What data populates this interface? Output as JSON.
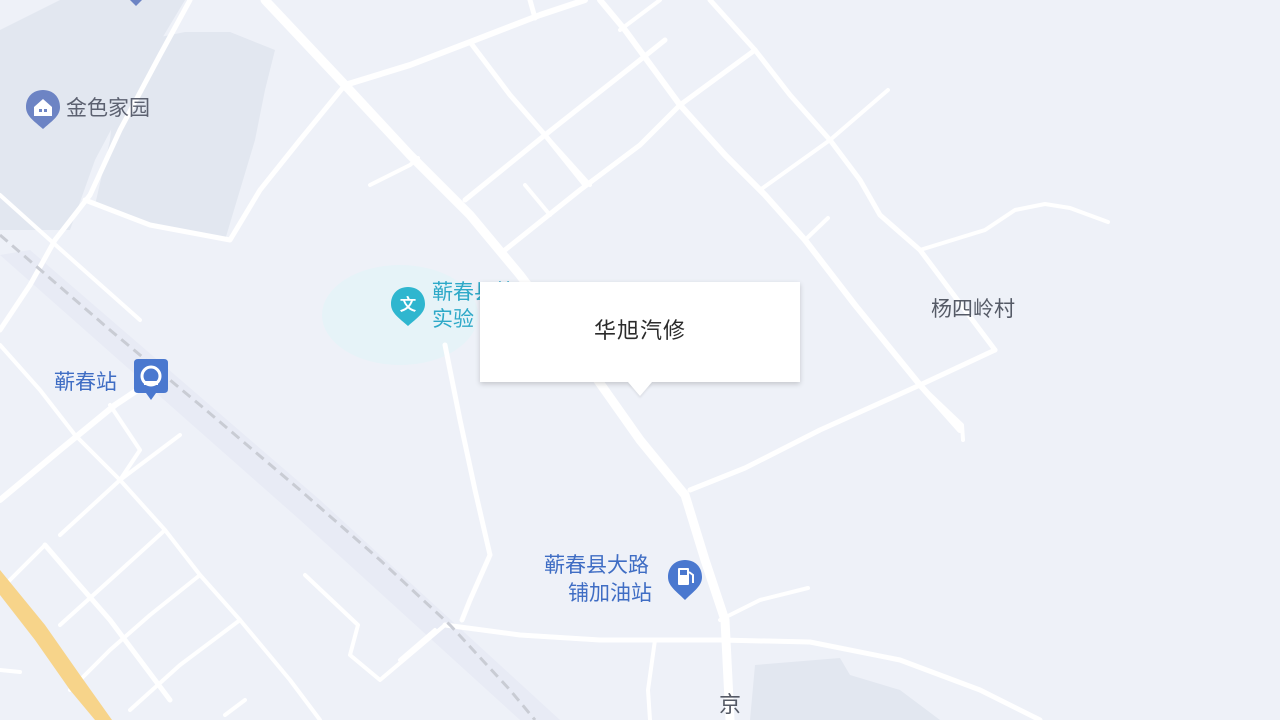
{
  "map": {
    "pois": {
      "jinse": {
        "label": "金色家园",
        "icon": "residential-icon"
      },
      "school": {
        "line1": "蕲春县第",
        "line2": "实验",
        "icon": "culture-icon"
      },
      "station": {
        "label": "蕲春站",
        "icon": "train-station-icon"
      },
      "gas": {
        "line1": "蕲春县大路",
        "line2": "铺加油站",
        "icon": "gas-station-icon"
      },
      "village": {
        "label": "杨四岭村"
      },
      "road": {
        "label": "京"
      }
    },
    "popup": {
      "title": "华旭汽修"
    },
    "colors": {
      "background": "#eef1f8",
      "road": "#ffffff",
      "highway": "#f7d48a",
      "block": "#e2e7f0",
      "poi_blue": "#4a78cf",
      "poi_teal": "#2fb6cf"
    }
  }
}
